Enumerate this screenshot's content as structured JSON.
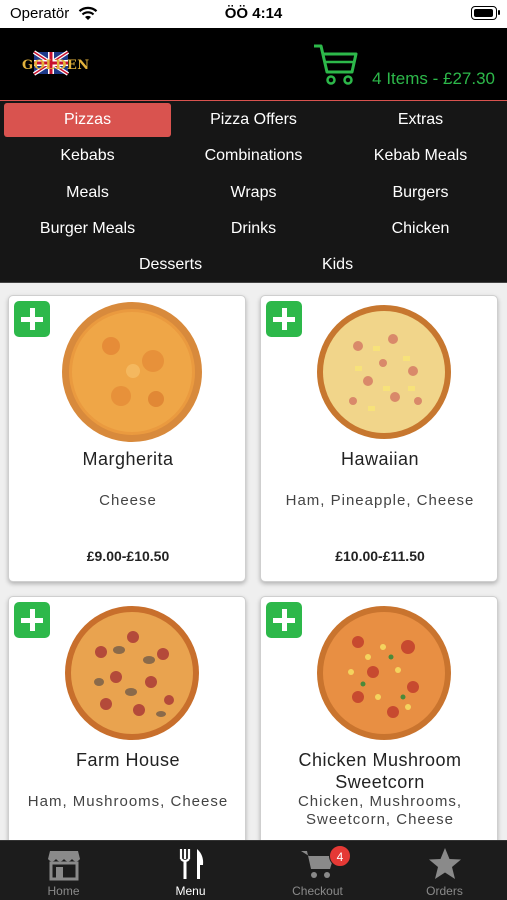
{
  "status_bar": {
    "carrier": "Operatör",
    "time": "ÖÖ 4:14"
  },
  "header": {
    "logo_text": "GOLDEN",
    "cart_summary": "4 Items - £27.30"
  },
  "categories": [
    {
      "label": "Pizzas",
      "active": true
    },
    {
      "label": "Pizza Offers"
    },
    {
      "label": "Extras"
    },
    {
      "label": "Kebabs"
    },
    {
      "label": "Combinations"
    },
    {
      "label": "Kebab Meals"
    },
    {
      "label": "Meals"
    },
    {
      "label": "Wraps"
    },
    {
      "label": "Burgers"
    },
    {
      "label": "Burger Meals"
    },
    {
      "label": "Drinks"
    },
    {
      "label": "Chicken"
    },
    {
      "label": "Desserts"
    },
    {
      "label": "Kids"
    }
  ],
  "products": [
    {
      "name": "Margherita",
      "description": "Cheese",
      "price": "£9.00-£10.50"
    },
    {
      "name": "Hawaiian",
      "description": "Ham, Pineapple, Cheese",
      "price": "£10.00-£11.50"
    },
    {
      "name": "Farm House",
      "description": "Ham, Mushrooms, Cheese",
      "price": ""
    },
    {
      "name": "Chicken Mushroom Sweetcorn",
      "description": "Chicken, Mushrooms, Sweetcorn, Cheese",
      "price": ""
    }
  ],
  "tabs": [
    {
      "label": "Home",
      "icon": "store-icon"
    },
    {
      "label": "Menu",
      "icon": "fork-knife-icon",
      "active": true
    },
    {
      "label": "Checkout",
      "icon": "cart-icon",
      "badge": "4"
    },
    {
      "label": "Orders",
      "icon": "star-icon"
    }
  ],
  "colors": {
    "accent_red": "#d9534f",
    "accent_green": "#2db84a",
    "header_bg": "#000000"
  }
}
